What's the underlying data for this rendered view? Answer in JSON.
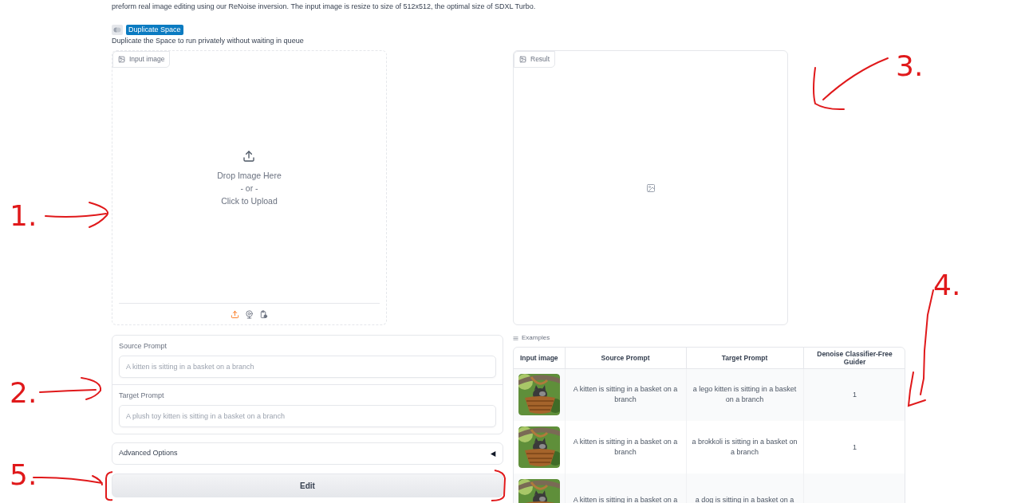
{
  "intro": "preform real image editing using our ReNoise inversion. The input image is resize to size of 512x512, the optimal size of SDXL Turbo.",
  "duplicate": {
    "label": "Duplicate Space",
    "note": "Duplicate the Space to run privately without waiting in queue"
  },
  "input_image": {
    "label": "Input image",
    "drop_text": "Drop Image Here",
    "or_text": "- or -",
    "click_text": "Click to Upload",
    "sources": [
      {
        "kind": "upload",
        "selected": true
      },
      {
        "kind": "webcam",
        "selected": false
      },
      {
        "kind": "clipboard",
        "selected": false
      }
    ]
  },
  "result": {
    "label": "Result"
  },
  "prompts": [
    {
      "label": "Source Prompt",
      "placeholder": "A kitten is sitting in a basket on a branch"
    },
    {
      "label": "Target Prompt",
      "placeholder": "A plush toy kitten is sitting in a basket on a branch"
    }
  ],
  "advanced": {
    "label": "Advanced Options",
    "expanded": false
  },
  "edit_button": "Edit",
  "examples": {
    "label": "Examples",
    "columns": [
      "Input image",
      "Source Prompt",
      "Target Prompt",
      "Denoise Classifier-Free Guider"
    ],
    "rows": [
      {
        "source": "A kitten is sitting in a basket on a branch",
        "target": "a lego kitten is sitting in a basket on a branch",
        "guidance": "1"
      },
      {
        "source": "A kitten is sitting in a basket on a branch",
        "target": "a brokkoli is sitting in a basket on a branch",
        "guidance": "1"
      },
      {
        "source": "A kitten is sitting in a basket on a",
        "target": "a dog is sitting in a basket on a"
      }
    ]
  },
  "annotations": [
    {
      "label": "1."
    },
    {
      "label": "2."
    },
    {
      "label": "3."
    },
    {
      "label": "4."
    },
    {
      "label": "5."
    }
  ]
}
